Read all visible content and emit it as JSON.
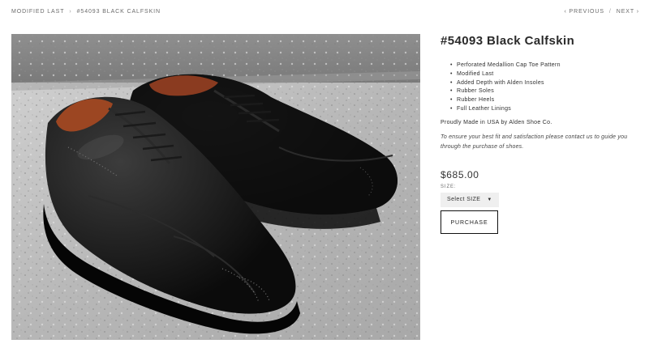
{
  "breadcrumb": {
    "home": "MODIFIED LAST",
    "separator": "›",
    "current": "#54093 BLACK CALFSKIN"
  },
  "pager": {
    "previous": "‹ PREVIOUS",
    "separator": "/",
    "next": "NEXT ›"
  },
  "product": {
    "title": "#54093 Black Calfskin",
    "features": [
      "Perforated Medallion Cap Toe Pattern",
      "Modified Last",
      "Added Depth with Alden Insoles",
      "Rubber Soles",
      "Rubber Heels",
      "Full Leather Linings"
    ],
    "made_in": "Proudly Made in USA by Alden Shoe Co.",
    "note": "To ensure your best fit and satisfaction please contact us to guide you through the purchase of shoes.",
    "price": "$685.00",
    "size_label": "SIZE:",
    "size_select": "Select SIZE",
    "purchase_label": "PURCHASE",
    "image_subject": "pair-of-black-calfskin-cap-toe-oxford-shoes"
  },
  "colors": {
    "text": "#333333",
    "muted": "#6b6b6b",
    "button_border": "#111111",
    "select_bg": "#efefef"
  }
}
